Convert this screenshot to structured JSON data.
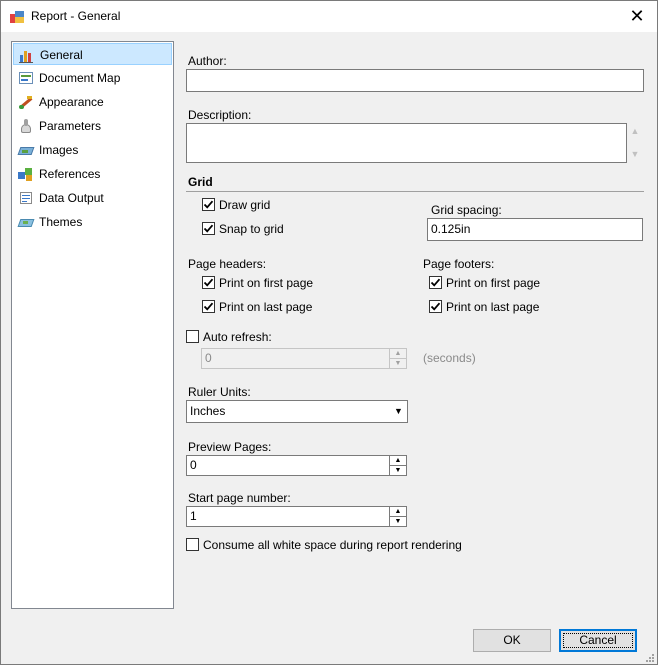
{
  "window": {
    "title": "Report - General"
  },
  "nav": {
    "items": [
      {
        "label": "General",
        "icon": "bar-chart-icon",
        "selected": true
      },
      {
        "label": "Document Map",
        "icon": "document-map-icon",
        "selected": false
      },
      {
        "label": "Appearance",
        "icon": "paint-brush-icon",
        "selected": false
      },
      {
        "label": "Parameters",
        "icon": "parameters-icon",
        "selected": false
      },
      {
        "label": "Images",
        "icon": "images-icon",
        "selected": false
      },
      {
        "label": "References",
        "icon": "references-icon",
        "selected": false
      },
      {
        "label": "Data Output",
        "icon": "data-output-icon",
        "selected": false
      },
      {
        "label": "Themes",
        "icon": "themes-icon",
        "selected": false
      }
    ]
  },
  "form": {
    "author": {
      "label": "Author:",
      "value": ""
    },
    "description": {
      "label": "Description:",
      "value": ""
    },
    "grid": {
      "heading": "Grid",
      "draw_grid": {
        "label": "Draw grid",
        "checked": true
      },
      "snap_to_grid": {
        "label": "Snap to grid",
        "checked": true
      },
      "spacing": {
        "label": "Grid spacing:",
        "value": "0.125in"
      }
    },
    "page_headers": {
      "label": "Page headers:",
      "first": {
        "label": "Print on first page",
        "checked": true
      },
      "last": {
        "label": "Print on last page",
        "checked": true
      }
    },
    "page_footers": {
      "label": "Page footers:",
      "first": {
        "label": "Print on first page",
        "checked": true
      },
      "last": {
        "label": "Print on last page",
        "checked": true
      }
    },
    "auto_refresh": {
      "label": "Auto refresh:",
      "checked": false,
      "value": "0",
      "unit": "(seconds)"
    },
    "ruler_units": {
      "label": "Ruler Units:",
      "value": "Inches"
    },
    "preview_pages": {
      "label": "Preview Pages:",
      "value": "0"
    },
    "start_page": {
      "label": "Start page number:",
      "value": "1"
    },
    "consume_whitespace": {
      "label": "Consume all white space during report rendering",
      "checked": false
    }
  },
  "buttons": {
    "ok": "OK",
    "cancel": "Cancel"
  },
  "colors": {
    "selection": "#cce8ff",
    "selection_border": "#99d1ff",
    "accent": "#0078d7",
    "dialog_bg": "#f0f0f0"
  }
}
